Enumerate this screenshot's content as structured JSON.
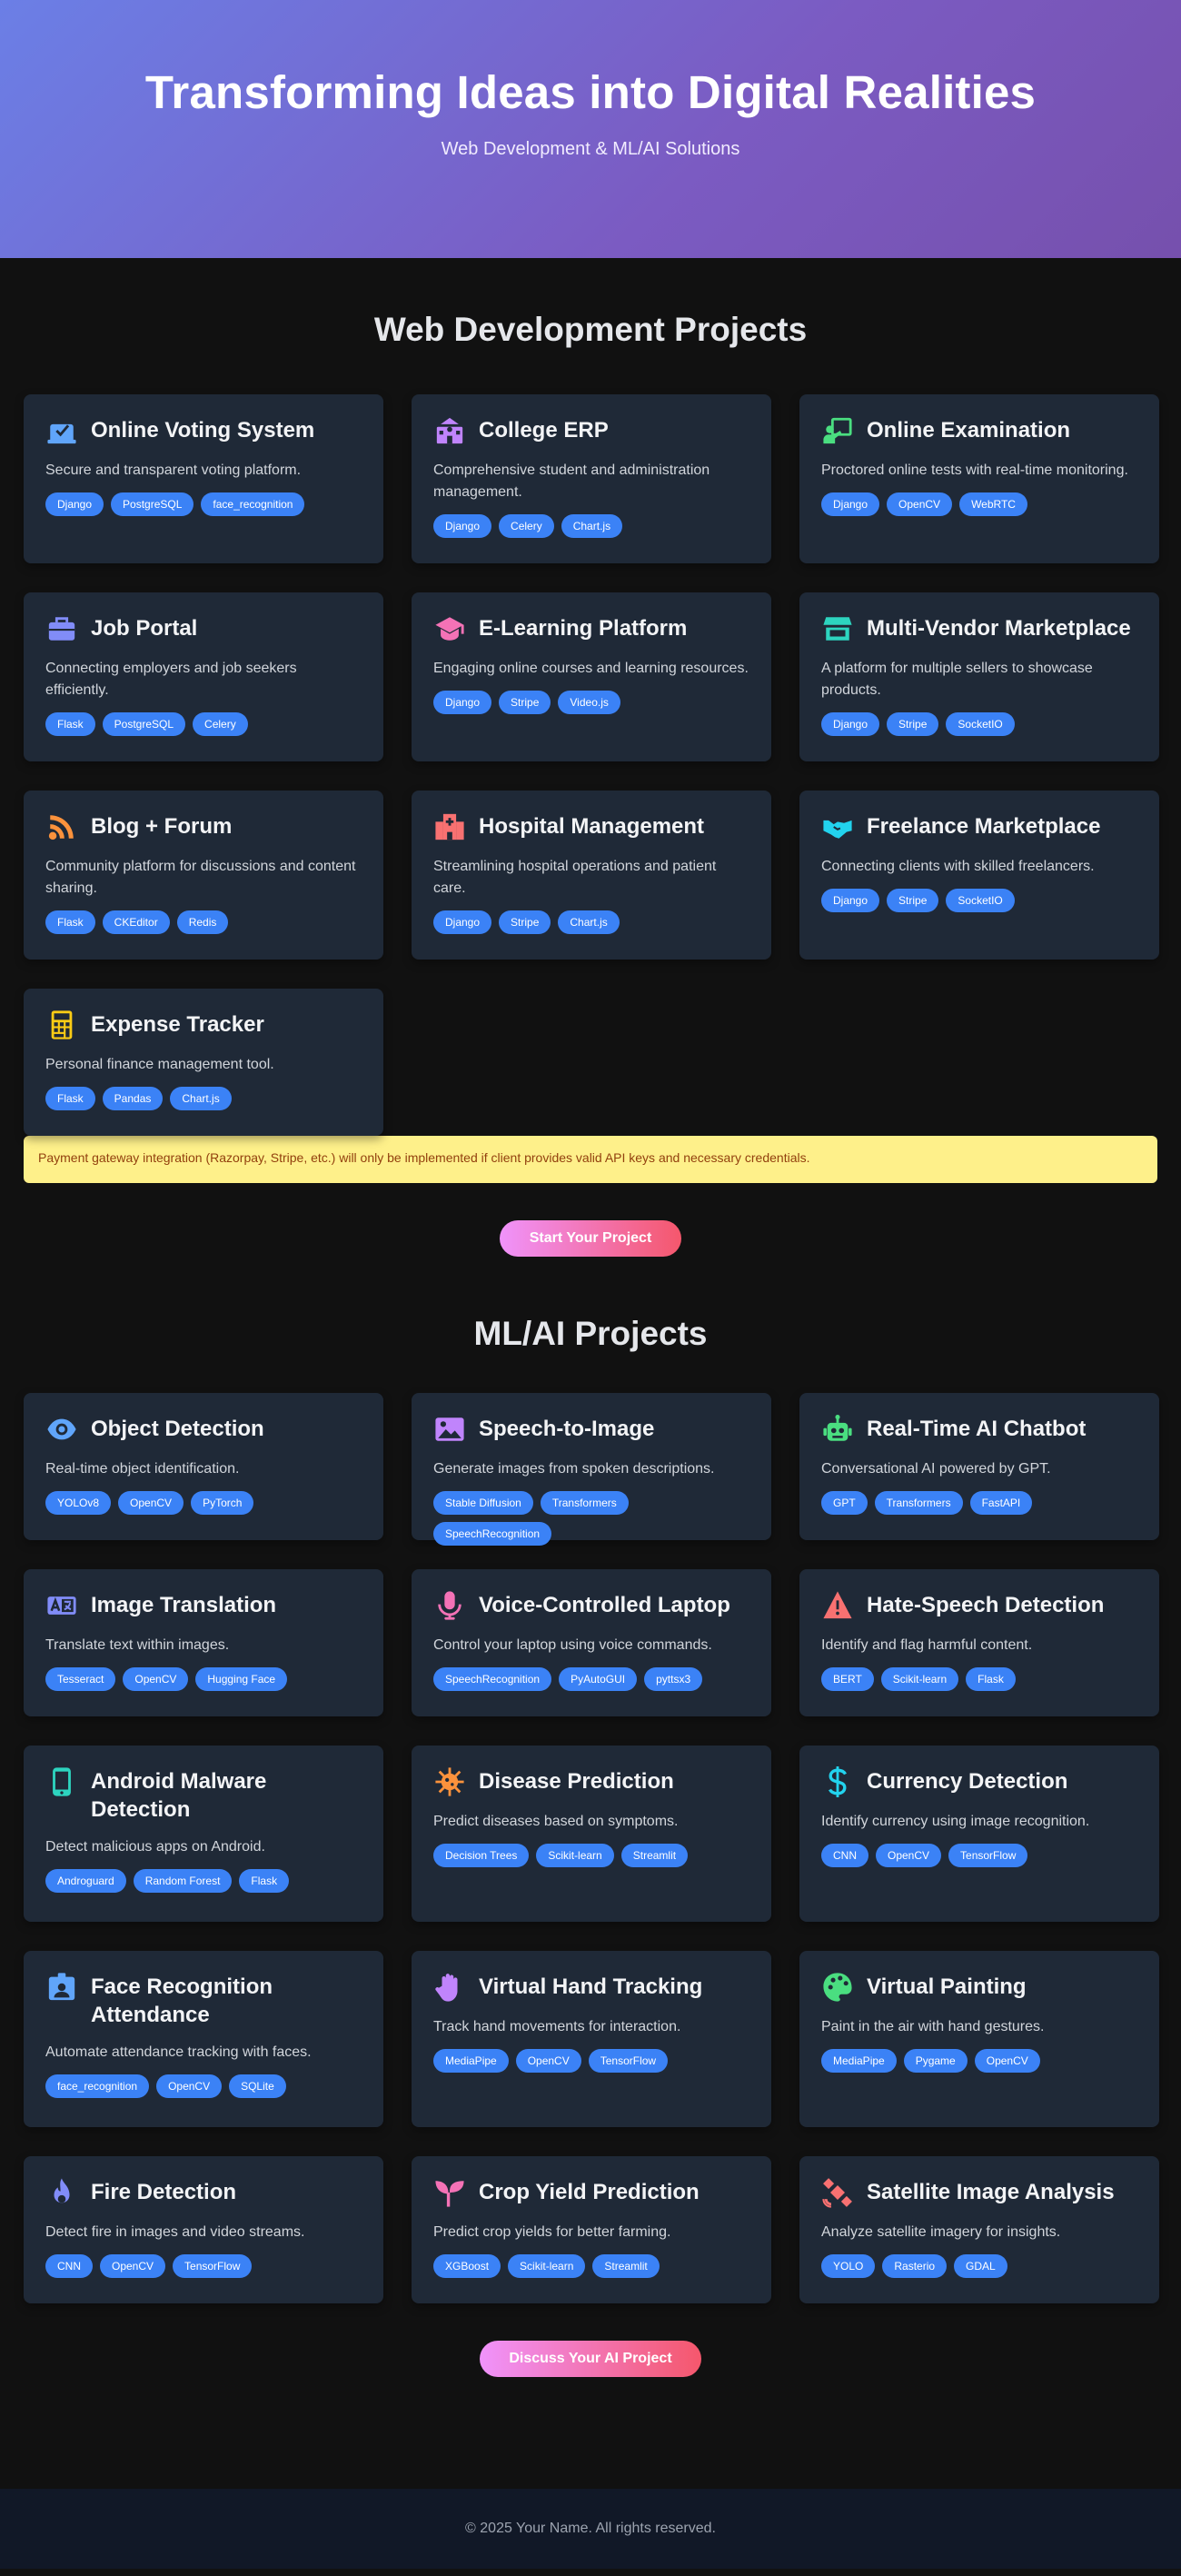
{
  "hero": {
    "title": "Transforming Ideas into Digital Realities",
    "subtitle": "Web Development & ML/AI Solutions",
    "gradient_start": "#6b7fe6",
    "gradient_end": "#7650ad"
  },
  "web": {
    "title": "Web Development Projects",
    "projects": [
      {
        "title": "Online Voting System",
        "icon": "vote-icon",
        "icon_color": "#60a5fa",
        "desc": "Secure and transparent voting platform.",
        "tags": [
          "Django",
          "PostgreSQL",
          "face_recognition"
        ]
      },
      {
        "title": "College ERP",
        "icon": "school-icon",
        "icon_color": "#c084fc",
        "desc": "Comprehensive student and administration management.",
        "tags": [
          "Django",
          "Celery",
          "Chart.js"
        ]
      },
      {
        "title": "Online Examination",
        "icon": "chalkboard-teacher-icon",
        "icon_color": "#4ade80",
        "desc": "Proctored online tests with real-time monitoring.",
        "tags": [
          "Django",
          "OpenCV",
          "WebRTC"
        ]
      },
      {
        "title": "Job Portal",
        "icon": "briefcase-icon",
        "icon_color": "#818cf8",
        "desc": "Connecting employers and job seekers efficiently.",
        "tags": [
          "Flask",
          "PostgreSQL",
          "Celery"
        ]
      },
      {
        "title": "E-Learning Platform",
        "icon": "graduation-cap-icon",
        "icon_color": "#f472b6",
        "desc": "Engaging online courses and learning resources.",
        "tags": [
          "Django",
          "Stripe",
          "Video.js"
        ]
      },
      {
        "title": "Multi-Vendor Marketplace",
        "icon": "store-icon",
        "icon_color": "#2dd4bf",
        "desc": "A platform for multiple sellers to showcase products.",
        "tags": [
          "Django",
          "Stripe",
          "SocketIO"
        ]
      },
      {
        "title": "Blog + Forum",
        "icon": "rss-icon",
        "icon_color": "#fb923c",
        "desc": "Community platform for discussions and content sharing.",
        "tags": [
          "Flask",
          "CKEditor",
          "Redis"
        ]
      },
      {
        "title": "Hospital Management",
        "icon": "hospital-icon",
        "icon_color": "#f87171",
        "desc": "Streamlining hospital operations and patient care.",
        "tags": [
          "Django",
          "Stripe",
          "Chart.js"
        ]
      },
      {
        "title": "Freelance Marketplace",
        "icon": "handshake-icon",
        "icon_color": "#22d3ee",
        "desc": "Connecting clients with skilled freelancers.",
        "tags": [
          "Django",
          "Stripe",
          "SocketIO"
        ]
      },
      {
        "title": "Expense Tracker",
        "icon": "calculator-icon",
        "icon_color": "#facc15",
        "desc": "Personal finance management tool.",
        "tags": [
          "Flask",
          "Pandas",
          "Chart.js"
        ]
      }
    ]
  },
  "notice": "Payment gateway integration (Razorpay, Stripe, etc.) will only be implemented if client provides valid API keys and necessary credentials.",
  "cta_web": "Start Your Project",
  "ml": {
    "title": "ML/AI Projects",
    "projects": [
      {
        "title": "Object Detection",
        "icon": "eye-icon",
        "icon_color": "#60a5fa",
        "desc": "Real-time object identification.",
        "tags": [
          "YOLOv8",
          "OpenCV",
          "PyTorch"
        ]
      },
      {
        "title": "Speech-to-Image",
        "icon": "image-icon",
        "icon_color": "#c084fc",
        "desc": "Generate images from spoken descriptions.",
        "tags": [
          "Stable Diffusion",
          "Transformers",
          "SpeechRecognition"
        ]
      },
      {
        "title": "Real-Time AI Chatbot",
        "icon": "robot-icon",
        "icon_color": "#4ade80",
        "desc": "Conversational AI powered by GPT.",
        "tags": [
          "GPT",
          "Transformers",
          "FastAPI"
        ]
      },
      {
        "title": "Image Translation",
        "icon": "language-icon",
        "icon_color": "#818cf8",
        "desc": "Translate text within images.",
        "tags": [
          "Tesseract",
          "OpenCV",
          "Hugging Face"
        ]
      },
      {
        "title": "Voice-Controlled Laptop",
        "icon": "microphone-icon",
        "icon_color": "#f472b6",
        "desc": "Control your laptop using voice commands.",
        "tags": [
          "SpeechRecognition",
          "PyAutoGUI",
          "pyttsx3"
        ]
      },
      {
        "title": "Hate-Speech Detection",
        "icon": "warning-icon",
        "icon_color": "#f87171",
        "desc": "Identify and flag harmful content.",
        "tags": [
          "BERT",
          "Scikit-learn",
          "Flask"
        ]
      },
      {
        "title": "Android Malware Detection",
        "icon": "mobile-icon",
        "icon_color": "#2dd4bf",
        "desc": "Detect malicious apps on Android.",
        "tags": [
          "Androguard",
          "Random Forest",
          "Flask"
        ]
      },
      {
        "title": "Disease Prediction",
        "icon": "virus-icon",
        "icon_color": "#fb923c",
        "desc": "Predict diseases based on symptoms.",
        "tags": [
          "Decision Trees",
          "Scikit-learn",
          "Streamlit"
        ]
      },
      {
        "title": "Currency Detection",
        "icon": "dollar-icon",
        "icon_color": "#22d3ee",
        "desc": "Identify currency using image recognition.",
        "tags": [
          "CNN",
          "OpenCV",
          "TensorFlow"
        ]
      },
      {
        "title": "Face Recognition Attendance",
        "icon": "id-badge-icon",
        "icon_color": "#60a5fa",
        "desc": "Automate attendance tracking with faces.",
        "tags": [
          "face_recognition",
          "OpenCV",
          "SQLite"
        ]
      },
      {
        "title": "Virtual Hand Tracking",
        "icon": "hand-icon",
        "icon_color": "#c084fc",
        "desc": "Track hand movements for interaction.",
        "tags": [
          "MediaPipe",
          "OpenCV",
          "TensorFlow"
        ]
      },
      {
        "title": "Virtual Painting",
        "icon": "palette-icon",
        "icon_color": "#4ade80",
        "desc": "Paint in the air with hand gestures.",
        "tags": [
          "MediaPipe",
          "Pygame",
          "OpenCV"
        ]
      },
      {
        "title": "Fire Detection",
        "icon": "fire-icon",
        "icon_color": "#818cf8",
        "desc": "Detect fire in images and video streams.",
        "tags": [
          "CNN",
          "OpenCV",
          "TensorFlow"
        ]
      },
      {
        "title": "Crop Yield Prediction",
        "icon": "seedling-icon",
        "icon_color": "#f472b6",
        "desc": "Predict crop yields for better farming.",
        "tags": [
          "XGBoost",
          "Scikit-learn",
          "Streamlit"
        ]
      },
      {
        "title": "Satellite Image Analysis",
        "icon": "satellite-icon",
        "icon_color": "#f87171",
        "desc": "Analyze satellite imagery for insights.",
        "tags": [
          "YOLO",
          "Rasterio",
          "GDAL"
        ]
      }
    ]
  },
  "cta_ml": "Discuss Your AI Project",
  "footer": "© 2025 Your Name. All rights reserved.",
  "colors": {
    "page_bg": "#111111",
    "card_bg": "#1f2937",
    "tag_bg": "#3b82f6",
    "notice_bg": "#fef08a",
    "notice_text": "#92400e",
    "cta_start": "#f093fb",
    "cta_end": "#f5576c",
    "footer_bg": "#111827"
  }
}
